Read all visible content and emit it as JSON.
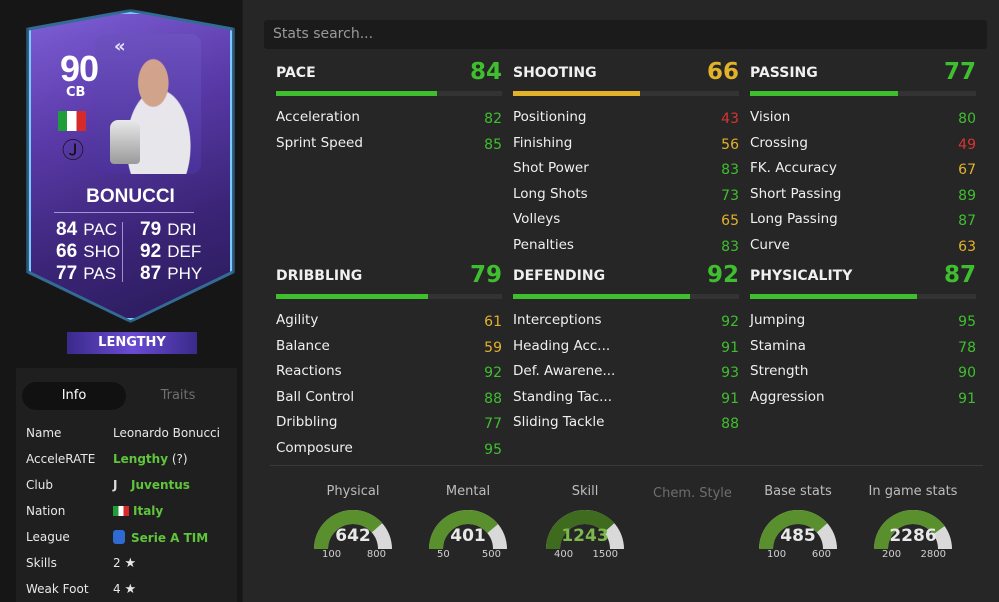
{
  "card": {
    "rating": "90",
    "position": "CB",
    "name": "BONUCCI",
    "stats_left": [
      {
        "value": "84",
        "label": "PAC"
      },
      {
        "value": "66",
        "label": "SHO"
      },
      {
        "value": "77",
        "label": "PAS"
      }
    ],
    "stats_right": [
      {
        "value": "79",
        "label": "DRI"
      },
      {
        "value": "92",
        "label": "DEF"
      },
      {
        "value": "87",
        "label": "PHY"
      }
    ],
    "playstyle": "LENGTHY",
    "back_icon": "double-chevron-left-icon",
    "card_gradient_top": "#7e5fd6",
    "card_border": "#7ac9ff"
  },
  "info": {
    "tab_info": "Info",
    "tab_traits": "Traits",
    "rows": [
      {
        "key": "Name",
        "value": "Leonardo Bonucci"
      },
      {
        "key": "AcceleRATE",
        "value": "Lengthy",
        "extra": "(?)"
      },
      {
        "key": "Club",
        "value": "Juventus"
      },
      {
        "key": "Nation",
        "value": "Italy"
      },
      {
        "key": "League",
        "value": "Serie A TIM"
      },
      {
        "key": "Skills",
        "value": "2",
        "star": "★"
      },
      {
        "key": "Weak Foot",
        "value": "4",
        "star": "★"
      }
    ]
  },
  "search": {
    "placeholder": "Stats search..."
  },
  "categories": [
    {
      "title": "PACE",
      "value": "84",
      "fill": 0.84,
      "color": "#3fbf2f",
      "valclass": "green",
      "subs": [
        {
          "n": "Acceleration",
          "v": "82",
          "c": "green"
        },
        {
          "n": "Sprint Speed",
          "v": "85",
          "c": "green"
        }
      ]
    },
    {
      "title": "SHOOTING",
      "value": "66",
      "fill": 0.66,
      "color": "#e3b22b",
      "valclass": "yellow",
      "subs": [
        {
          "n": "Positioning",
          "v": "43",
          "c": "red"
        },
        {
          "n": "Finishing",
          "v": "56",
          "c": "yellow"
        },
        {
          "n": "Shot Power",
          "v": "83",
          "c": "green"
        },
        {
          "n": "Long Shots",
          "v": "73",
          "c": "green"
        },
        {
          "n": "Volleys",
          "v": "65",
          "c": "yellow"
        },
        {
          "n": "Penalties",
          "v": "83",
          "c": "green"
        }
      ]
    },
    {
      "title": "PASSING",
      "value": "77",
      "fill": 0.77,
      "color": "#3fbf2f",
      "valclass": "green",
      "subs": [
        {
          "n": "Vision",
          "v": "80",
          "c": "green"
        },
        {
          "n": "Crossing",
          "v": "49",
          "c": "red"
        },
        {
          "n": "FK. Accuracy",
          "v": "67",
          "c": "yellow"
        },
        {
          "n": "Short Passing",
          "v": "89",
          "c": "green"
        },
        {
          "n": "Long Passing",
          "v": "87",
          "c": "green"
        },
        {
          "n": "Curve",
          "v": "63",
          "c": "yellow"
        }
      ]
    },
    {
      "title": "DRIBBLING",
      "value": "79",
      "fill": 0.79,
      "color": "#3fbf2f",
      "valclass": "green",
      "subs": [
        {
          "n": "Agility",
          "v": "61",
          "c": "yellow"
        },
        {
          "n": "Balance",
          "v": "59",
          "c": "yellow"
        },
        {
          "n": "Reactions",
          "v": "92",
          "c": "green"
        },
        {
          "n": "Ball Control",
          "v": "88",
          "c": "green"
        },
        {
          "n": "Dribbling",
          "v": "77",
          "c": "green"
        },
        {
          "n": "Composure",
          "v": "95",
          "c": "green"
        }
      ]
    },
    {
      "title": "DEFENDING",
      "value": "92",
      "fill": 0.92,
      "color": "#3fbf2f",
      "valclass": "green",
      "subs": [
        {
          "n": "Interceptions",
          "v": "92",
          "c": "green"
        },
        {
          "n": "Heading Acc...",
          "v": "91",
          "c": "green"
        },
        {
          "n": "Def. Awarene...",
          "v": "93",
          "c": "green"
        },
        {
          "n": "Standing Tac...",
          "v": "91",
          "c": "green"
        },
        {
          "n": "Sliding Tackle",
          "v": "88",
          "c": "green"
        }
      ]
    },
    {
      "title": "PHYSICALITY",
      "value": "87",
      "fill": 0.87,
      "color": "#3fbf2f",
      "valclass": "green",
      "subs": [
        {
          "n": "Jumping",
          "v": "95",
          "c": "green"
        },
        {
          "n": "Stamina",
          "v": "78",
          "c": "green"
        },
        {
          "n": "Strength",
          "v": "90",
          "c": "green"
        },
        {
          "n": "Aggression",
          "v": "91",
          "c": "green"
        }
      ]
    }
  ],
  "gauges": [
    {
      "title": "Physical",
      "value": "642",
      "min": "100",
      "max": "800",
      "fill": 0.77,
      "dim": false
    },
    {
      "title": "Mental",
      "value": "401",
      "min": "50",
      "max": "500",
      "fill": 0.78,
      "dim": false
    },
    {
      "title": "Skill",
      "value": "1243",
      "min": "400",
      "max": "1500",
      "fill": 0.77,
      "dim": true
    },
    {
      "title": "Base stats",
      "value": "485",
      "min": "100",
      "max": "600",
      "fill": 0.77,
      "dim": false
    },
    {
      "title": "In game stats",
      "value": "2286",
      "min": "200",
      "max": "2800",
      "fill": 0.8,
      "dim": false
    }
  ],
  "chem_style": "Chem. Style",
  "colors": {
    "green": "#3fbf2f",
    "yellow": "#e3b22b",
    "red": "#d93333",
    "gauge_track": "#d9d9d9",
    "gauge_fill": "#5a8f2e"
  }
}
